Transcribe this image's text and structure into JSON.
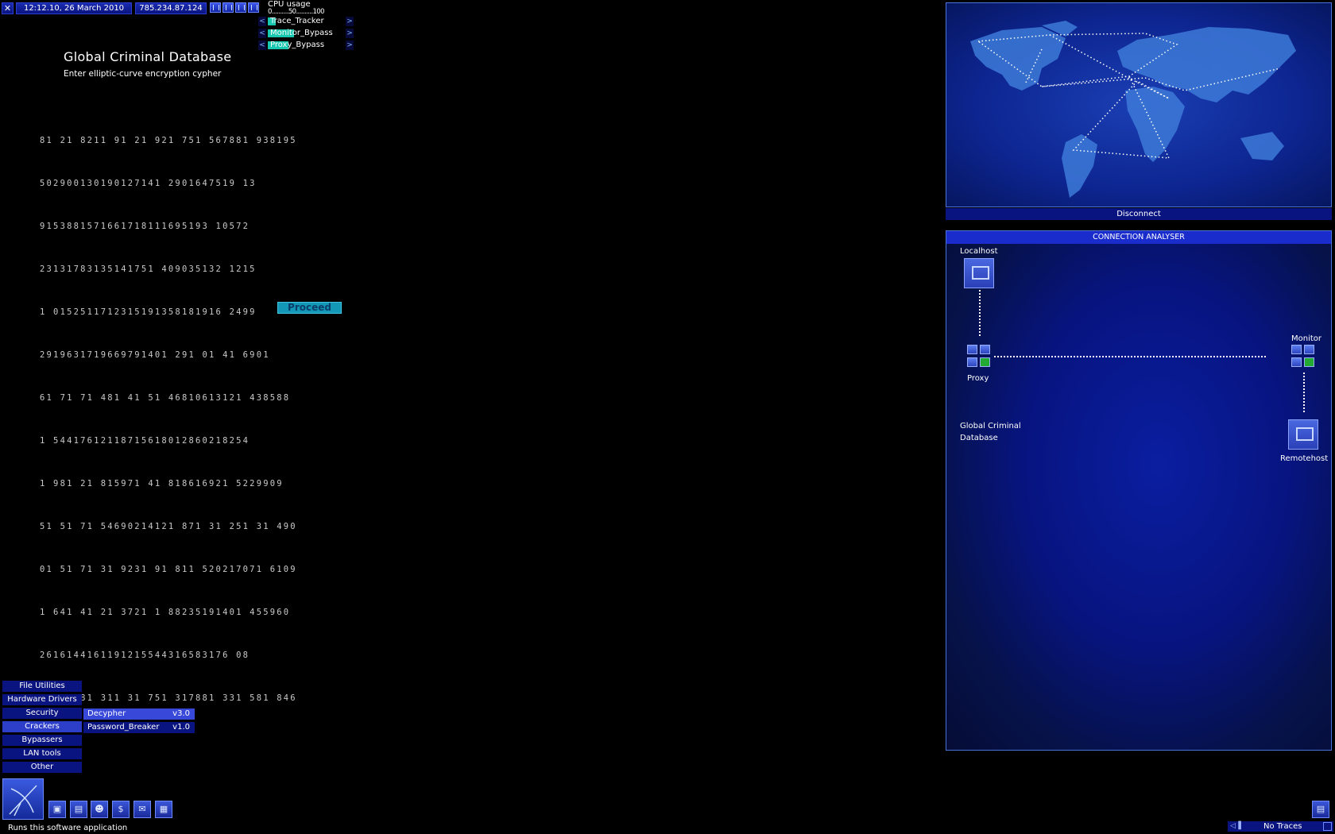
{
  "topbar": {
    "date": "12:12.10, 26 March 2010",
    "ip": "785.234.87.124",
    "cpu_label": "CPU usage",
    "cpu_scale": "0..........50..........100",
    "programs": [
      {
        "name": "Trace_Tracker",
        "cpu_fraction": 0.08
      },
      {
        "name": "Monitor_Bypass",
        "cpu_fraction": 0.3
      },
      {
        "name": "Proxy_Bypass",
        "cpu_fraction": 0.25
      }
    ]
  },
  "screen": {
    "title": "Global Criminal Database",
    "subtitle": "Enter elliptic-curve encryption cypher",
    "cypher_rows": [
      "81 21 8211 91 21 921 751 567881 938195",
      "502900130190127141 2901647519 13",
      "9153881571661718111695193 10572",
      "23131783135141751 409035132 1215",
      "1 0152511712315191358181916 2499",
      "2919631719669791401 291 01 41 6901",
      "61 71 71 481 41 51 46810613121 438588",
      "1 54417612118715618012860218254",
      "1 981 21 815971 41 818616921 5229909",
      "51 51 71 54690214121 871 31 251 31 490",
      "01 51 71 31 9231 91 811 520217071 6109",
      "1 641 41 21 3721 1 88235191401 455960",
      "2616144161191215544316583176 08",
      "51 97181 311 31 751 317881 331 581 846"
    ],
    "proceed_label": "Proceed"
  },
  "map_panel": {
    "disconnect_label": "Disconnect"
  },
  "connection": {
    "title": "CONNECTION ANALYSER",
    "localhost_label": "Localhost",
    "proxy_label": "Proxy",
    "monitor_label": "Monitor",
    "target_label_1": "Global Criminal",
    "target_label_2": "Database",
    "remotehost_label": "Remotehost"
  },
  "software_menu": {
    "categories": [
      "File Utilities",
      "Hardware Drivers",
      "Security",
      "Crackers",
      "Bypassers",
      "LAN tools",
      "Other"
    ],
    "active_category": "Crackers",
    "submenu": [
      {
        "name": "Decypher",
        "version": "v3.0"
      },
      {
        "name": "Password_Breaker",
        "version": "v1.0"
      }
    ]
  },
  "status": {
    "help_text": "Runs this software application",
    "traces": "No Traces"
  }
}
